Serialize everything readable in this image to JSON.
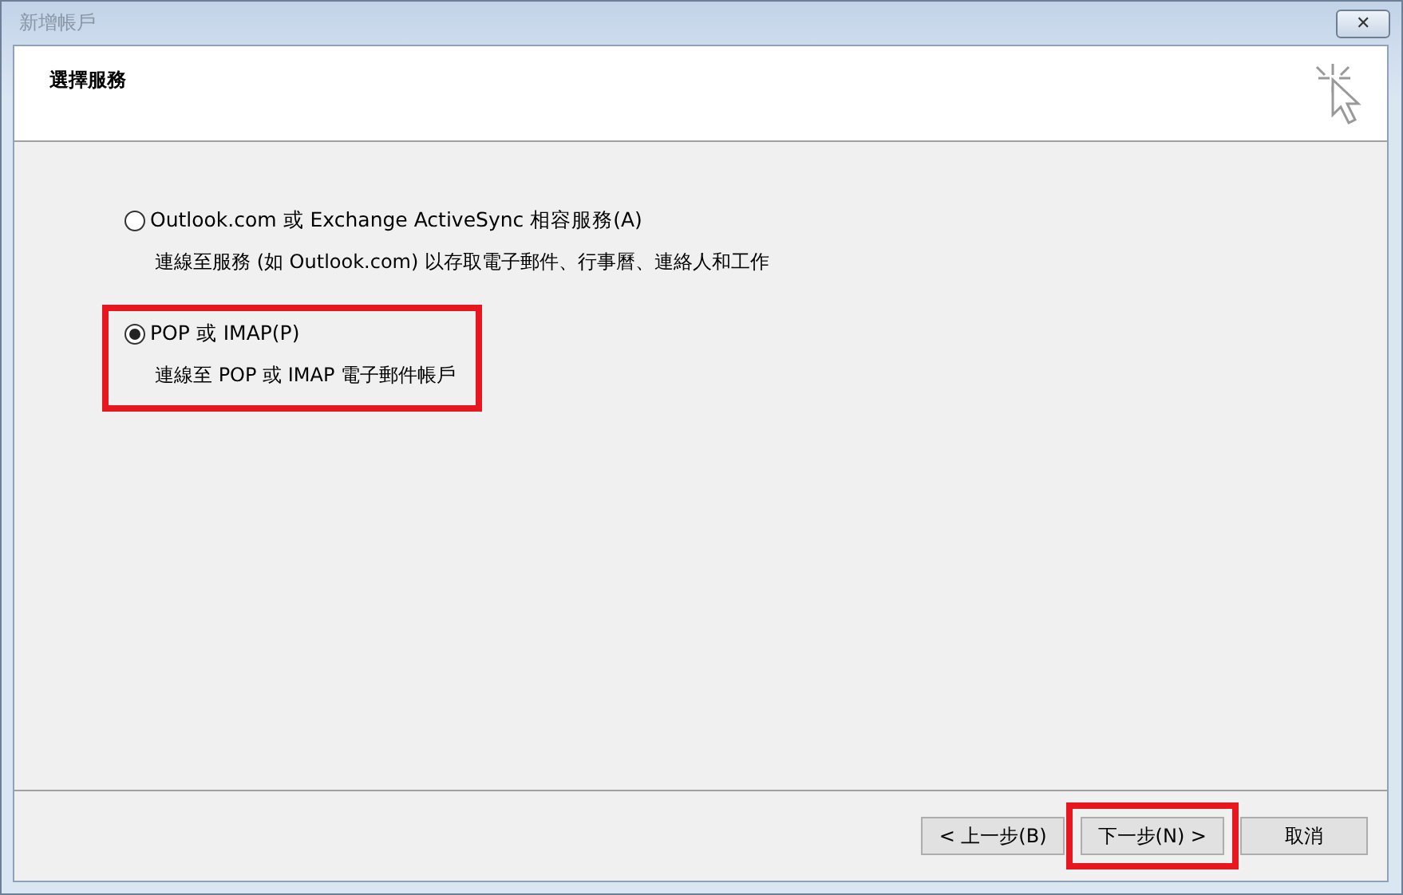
{
  "window": {
    "title": "新增帳戶",
    "close_glyph": "✕"
  },
  "header": {
    "title": "選擇服務"
  },
  "options": [
    {
      "label": "Outlook.com 或 Exchange ActiveSync 相容服務(A)",
      "description": "連線至服務 (如 Outlook.com) 以存取電子郵件、行事曆、連絡人和工作",
      "selected": false,
      "highlighted": false
    },
    {
      "label": "POP 或 IMAP(P)",
      "description": "連線至 POP 或 IMAP 電子郵件帳戶",
      "selected": true,
      "highlighted": true
    }
  ],
  "buttons": [
    {
      "label": "< 上一步(B)",
      "highlighted": false
    },
    {
      "label": "下一步(N) >",
      "highlighted": true
    },
    {
      "label": "取消",
      "highlighted": false
    }
  ]
}
